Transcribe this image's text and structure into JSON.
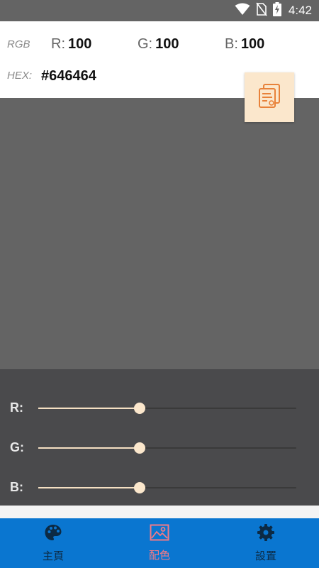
{
  "status_bar": {
    "time": "4:42"
  },
  "info": {
    "rgb_label": "RGB",
    "r_key": "R:",
    "r_value": "100",
    "g_key": "G:",
    "g_value": "100",
    "b_key": "B:",
    "b_value": "100",
    "hex_label": "HEX:",
    "hex_value": "#646464"
  },
  "preview": {
    "color": "#646464"
  },
  "sliders": [
    {
      "label": "R:",
      "value": 100,
      "max": 255
    },
    {
      "label": "G:",
      "value": 100,
      "max": 255
    },
    {
      "label": "B:",
      "value": 100,
      "max": 255
    }
  ],
  "nav": {
    "home_label": "主頁",
    "color_label": "配色",
    "settings_label": "設置",
    "active": "color"
  },
  "colors": {
    "accent": "#fbe7cc",
    "nav_background": "#0a76d0",
    "active_nav": "#f27a86",
    "copy_icon": "#e8823a"
  },
  "icons": [
    "wifi-icon",
    "no-sim-icon",
    "battery-charging-icon",
    "copy-icon",
    "palette-icon",
    "image-icon",
    "gear-icon"
  ]
}
